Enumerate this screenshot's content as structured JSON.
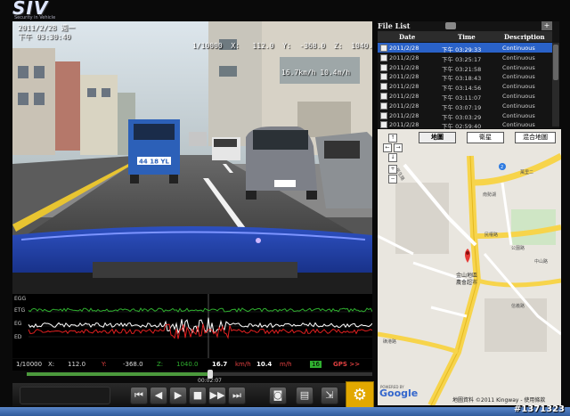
{
  "app": {
    "logo": "SIV",
    "tagline": "Security in Vehicle"
  },
  "osd": {
    "date_line": "2011/2/28 週一",
    "time_line": "下午 03:30:40",
    "right_line1": "1/10000  X:   112.0  Y:  -368.0  Z:  1040.0",
    "right_line2": "16.7km/h 10.4m/h",
    "plate": "44 18 YL"
  },
  "graph": {
    "labels": [
      "EGG",
      "ETG",
      "EG",
      "ED"
    ]
  },
  "status": {
    "scale": "1/10000",
    "x_label": "X:",
    "x_val": "112.0",
    "y_label": "Y:",
    "y_val": "-368.0",
    "z_label": "Z:",
    "z_val": "1040.0",
    "speed_kmh": "16.7",
    "kmh_unit": "km/h",
    "speed_mph": "10.4",
    "mph_unit": "m/h",
    "sat_count": "16",
    "gps": "GPS >>"
  },
  "playback": {
    "elapsed": "00:02:07",
    "progress_fraction": 0.53
  },
  "file_list": {
    "title": "File List",
    "columns": [
      "Date",
      "Time",
      "Description"
    ],
    "rows": [
      {
        "date": "2011/2/28",
        "time": "下午 03:29:33",
        "desc": "Continuous",
        "selected": true
      },
      {
        "date": "2011/2/28",
        "time": "下午 03:25:17",
        "desc": "Continuous"
      },
      {
        "date": "2011/2/28",
        "time": "下午 03:21:58",
        "desc": "Continuous"
      },
      {
        "date": "2011/2/28",
        "time": "下午 03:18:43",
        "desc": "Continuous"
      },
      {
        "date": "2011/2/28",
        "time": "下午 03:14:56",
        "desc": "Continuous"
      },
      {
        "date": "2011/2/28",
        "time": "下午 03:11:07",
        "desc": "Continuous"
      },
      {
        "date": "2011/2/28",
        "time": "下午 03:07:19",
        "desc": "Continuous"
      },
      {
        "date": "2011/2/28",
        "time": "下午 03:03:29",
        "desc": "Continuous"
      },
      {
        "date": "2011/2/28",
        "time": "下午 02:59:40",
        "desc": "Continuous"
      }
    ]
  },
  "map": {
    "btn_map": "地圖",
    "btn_satellite": "衛星",
    "btn_hybrid": "混合地圖",
    "poi": "金山地區\n農會超市",
    "streets": [
      "民生路",
      "民權路",
      "南勢湖",
      "公園路",
      "萬里二",
      "信義路",
      "中山路",
      "磺港路"
    ],
    "copyright": "地圖資料 ©2011 Kingway - 使用條款",
    "google": "Google",
    "powered": "POWERED BY"
  },
  "watermark": "#1371323",
  "colors": {
    "selection": "#2a62c8",
    "accent": "#e2a800",
    "graph_green": "#2faf2f",
    "graph_red": "#e02020"
  }
}
